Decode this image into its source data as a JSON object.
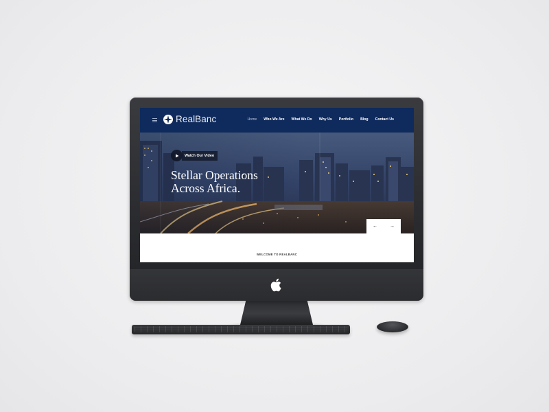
{
  "site": {
    "brand": "RealBanc",
    "nav": [
      {
        "label": "Home",
        "active": true
      },
      {
        "label": "Who We Are"
      },
      {
        "label": "What We Do"
      },
      {
        "label": "Why Us"
      },
      {
        "label": "Portfolio"
      },
      {
        "label": "Blog"
      },
      {
        "label": "Contact Us"
      }
    ],
    "hero": {
      "video_label": "Watch Our Video",
      "title_line1": "Stellar Operations",
      "title_line2": "Across Africa.",
      "prev_icon": "arrow-left-icon",
      "next_icon": "arrow-right-icon"
    },
    "welcome": "WELCOME TO REALBANC"
  },
  "colors": {
    "header_bg": "#0f2a5c",
    "background": "#ececee",
    "monitor": "#2a2b2e"
  }
}
